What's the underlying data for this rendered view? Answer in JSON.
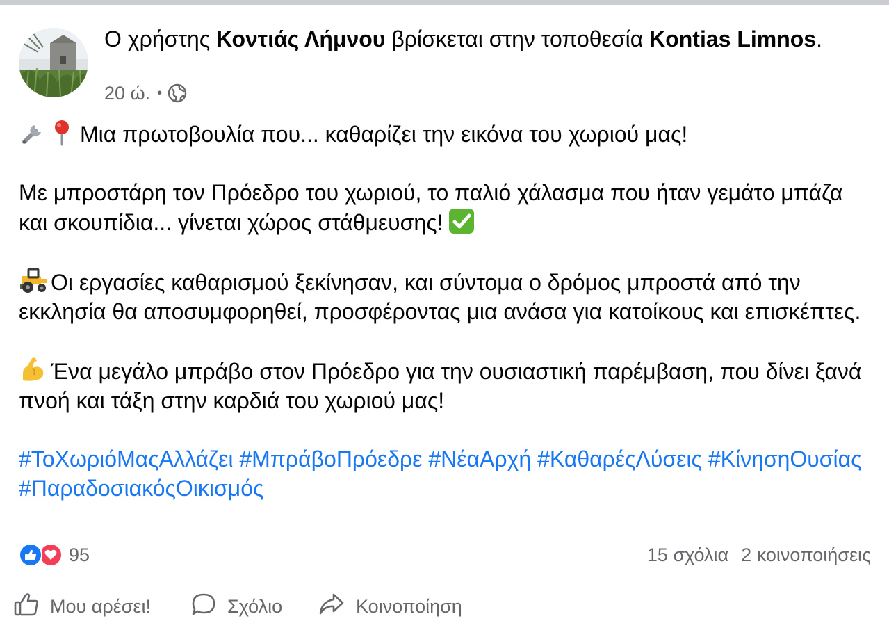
{
  "header": {
    "prefix": "Ο χρήστης ",
    "author": "Κοντιάς Λήμνου",
    "middle": " βρίσκεται στην τοποθεσία ",
    "location": "Kontias Limnos",
    "suffix": ".",
    "time": "20 ώ.",
    "audience_icon": "globe-icon"
  },
  "body": {
    "p1_icons": [
      "wrench-icon",
      "pin-icon"
    ],
    "p1": "Μια πρωτοβουλία που... καθαρίζει την εικόνα του χωριού μας!",
    "p2": "Με μπροστάρη τον Πρόεδρο του χωριού, το παλιό χάλασμα που ήταν γεμάτο μπάζα και σκουπίδια... γίνεται χώρος στάθμευσης!",
    "p2_icon": "check-mark-icon",
    "p3_icon": "tractor-icon",
    "p3": "Οι εργασίες καθαρισμού ξεκίνησαν, και σύντομα ο δρόμος μπροστά από την εκκλησία θα αποσυμφορηθεί, προσφέροντας μια ανάσα για κατοίκους και επισκέπτες.",
    "p4_icon": "flexed-biceps-icon",
    "p4": "Ένα μεγάλο μπράβο στον Πρόεδρο για την ουσιαστική παρέμβαση, που δίνει ξανά πνοή και τάξη στην καρδιά του χωριού μας!",
    "hashtags": [
      "#ΤοΧωριόΜαςΑλλάζει",
      "#ΜπράβοΠρόεδρε",
      "#ΝέαΑρχή",
      "#ΚαθαρέςΛύσεις",
      "#ΚίνησηΟυσίας",
      "#ΠαραδοσιακόςΟικισμός"
    ]
  },
  "stats": {
    "reaction_count": "95",
    "comments": "15 σχόλια",
    "shares": "2 κοινοποιήσεις"
  },
  "actions": {
    "like": "Μου αρέσει!",
    "comment": "Σχόλιο",
    "share": "Κοινοποίηση"
  },
  "colors": {
    "link": "#1877f2",
    "secondary": "#65676b",
    "like": "#1877f2",
    "love": "#f33e58"
  }
}
